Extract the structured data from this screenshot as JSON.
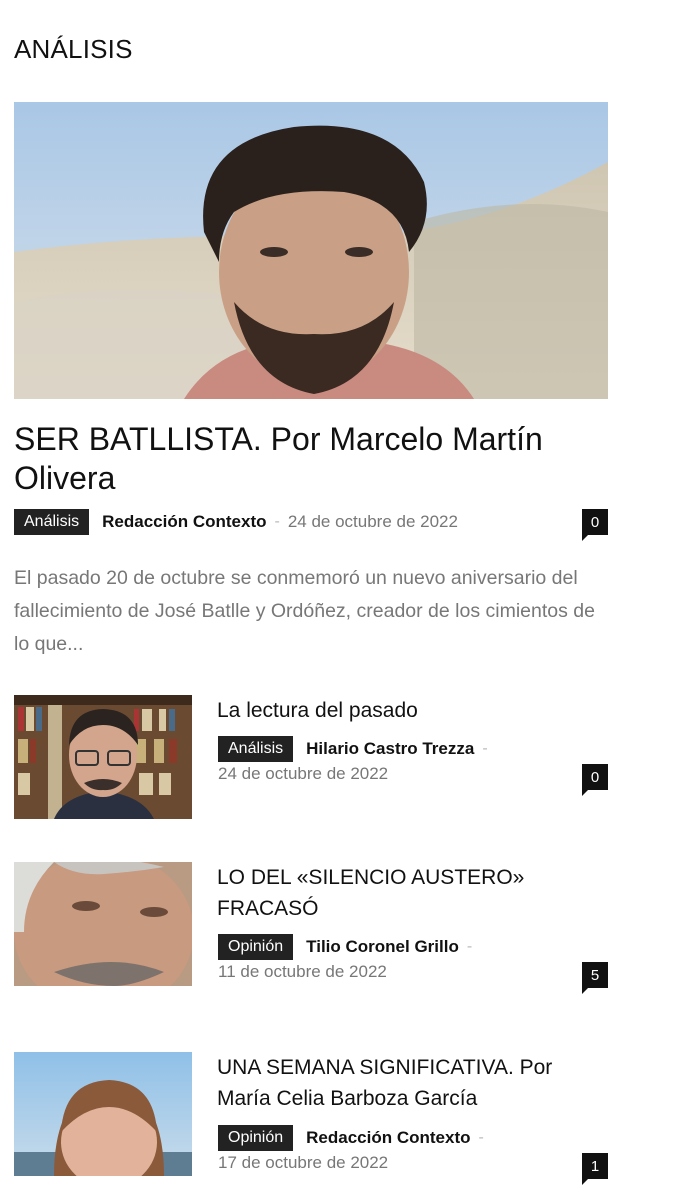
{
  "section": {
    "title": "ANÁLISIS"
  },
  "featured": {
    "title": "SER BATLLISTA. Por Marcelo Martín Olivera",
    "category": "Análisis",
    "author": "Redacción Contexto",
    "separator": "-",
    "date": "24 de octubre de 2022",
    "comments": "0",
    "excerpt": "El pasado 20 de octubre se conmemoró un nuevo aniversario del fallecimiento de José Batlle y Ordóñez, creador de los cimientos de lo que..."
  },
  "items": [
    {
      "title": "La lectura del pasado",
      "category": "Análisis",
      "author": "Hilario Castro Trezza",
      "separator": "-",
      "date": "24 de octubre de 2022",
      "comments": "0"
    },
    {
      "title": "LO DEL «SILENCIO AUSTERO» FRACASÓ",
      "category": "Opinión",
      "author": "Tilio Coronel Grillo",
      "separator": "-",
      "date": "11 de octubre de 2022",
      "comments": "5"
    },
    {
      "title": "UNA SEMANA SIGNIFICATIVA. Por María Celia Barboza García",
      "category": "Opinión",
      "author": "Redacción Contexto",
      "separator": "-",
      "date": "17 de octubre de 2022",
      "comments": "1"
    }
  ]
}
